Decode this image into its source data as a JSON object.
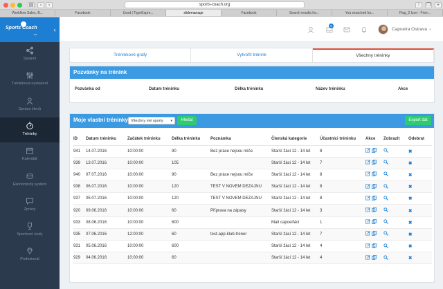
{
  "browser": {
    "url": "sports-coach.org",
    "tabs": [
      "Workflow Sales, B...",
      "Facebook",
      "Úvod | TigerExpre...",
      "slidemanage",
      "Facebook",
      "Search results for...",
      "You searched for...",
      "Flag_2 Icon - Free..."
    ]
  },
  "app": {
    "logo_text": "Sports Coach",
    "logo_sub": ".cz"
  },
  "sidebar": {
    "items": [
      {
        "label": "Spojení",
        "icon": "share-icon"
      },
      {
        "label": "Tréninková nastavení",
        "icon": "sliders-icon"
      },
      {
        "label": "Správa členů",
        "icon": "users-icon"
      },
      {
        "label": "Tréninky",
        "icon": "stopwatch-icon"
      },
      {
        "label": "Kalendář",
        "icon": "calendar-icon"
      },
      {
        "label": "Ekonomický systém",
        "icon": "coins-icon"
      },
      {
        "label": "Zprávy",
        "icon": "chat-icon"
      },
      {
        "label": "Sportovní body",
        "icon": "trophy-icon"
      },
      {
        "label": "Profesionál",
        "icon": "diamond-icon"
      }
    ],
    "active_index": 3
  },
  "topbar": {
    "notification_count": "5",
    "user_name": "Capoeira Ostrava"
  },
  "view_tabs": [
    "Tréninkové grafy",
    "Vytvořit trénink",
    "Všechny tréninky"
  ],
  "invitations": {
    "title": "Pozvánky na trénink",
    "columns": [
      "Pozvánka od",
      "Datum tréninku",
      "Délka tréninku",
      "Název tréninku",
      "Akce"
    ]
  },
  "trainings": {
    "title": "Moje vlastní tréninky",
    "filter_value": "Všechny mé sporty",
    "search_label": "Hledat",
    "export_label": "Export dat",
    "columns": [
      "ID",
      "Datum tréninku",
      "Začátek tréninku",
      "Délka tréninku",
      "Poznámka",
      "Členská kategorie",
      "Účastníci tréninku",
      "Akce",
      "Zobrazit",
      "Odebrat"
    ],
    "rows": [
      {
        "id": "941",
        "date": "14.07.2016",
        "start": "10:00:00",
        "length": "90",
        "note": "Bez práce nejsou míče",
        "category": "Starší žáci 12 - 14 let",
        "count": "8"
      },
      {
        "id": "939",
        "date": "13.07.2016",
        "start": "10:00:00",
        "length": "105",
        "note": "",
        "category": "Starší žáci 12 - 14 let",
        "count": "7"
      },
      {
        "id": "940",
        "date": "07.07.2016",
        "start": "10:00:00",
        "length": "90",
        "note": "Bez práce nejsou míče",
        "category": "Starší žáci 12 - 14 let",
        "count": "8"
      },
      {
        "id": "938",
        "date": "06.07.2016",
        "start": "10:00:00",
        "length": "120",
        "note": "TEST V NOVEM DEZAJNU",
        "category": "Starší žáci 12 - 14 let",
        "count": "8"
      },
      {
        "id": "937",
        "date": "05.07.2016",
        "start": "10:00:00",
        "length": "120",
        "note": "TEST V NOVEM DEZAJNU",
        "category": "Starší žáci 12 - 14 let",
        "count": "8"
      },
      {
        "id": "920",
        "date": "09.06.2016",
        "start": "10:00:00",
        "length": "60",
        "note": "Příprava na zápasy",
        "category": "Starší žáci 12 - 14 let",
        "count": "3"
      },
      {
        "id": "933",
        "date": "08.06.2016",
        "start": "10:00:00",
        "length": "600",
        "note": "",
        "category": "Malí capoeiřáci",
        "count": "1"
      },
      {
        "id": "935",
        "date": "07.06.2016",
        "start": "12:00:00",
        "length": "60",
        "note": "test-app-klub-trener",
        "category": "Starší žáci 12 - 14 let",
        "count": "7"
      },
      {
        "id": "931",
        "date": "05.06.2016",
        "start": "10:00:00",
        "length": "600",
        "note": "",
        "category": "Starší žáci 12 - 14 let",
        "count": "4"
      },
      {
        "id": "929",
        "date": "04.06.2016",
        "start": "10:00:00",
        "length": "60",
        "note": "",
        "category": "Starší žáci 12 - 14 let",
        "count": "4"
      }
    ]
  }
}
